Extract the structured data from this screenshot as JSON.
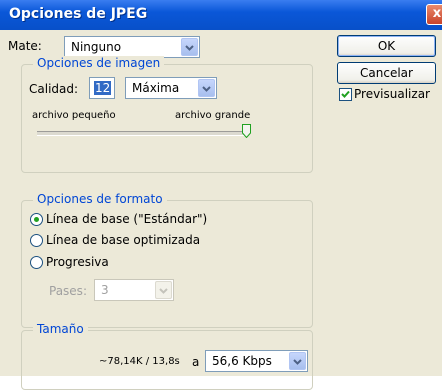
{
  "window": {
    "title": "Opciones de JPEG",
    "close_glyph": "x"
  },
  "matte": {
    "label": "Mate:",
    "value": "Ninguno"
  },
  "buttons": {
    "ok": "OK",
    "cancel": "Cancelar"
  },
  "preview": {
    "label": "Previsualizar",
    "checked": true
  },
  "image_options": {
    "legend": "Opciones de imagen",
    "quality_label": "Calidad:",
    "quality_value": "12",
    "quality_preset": "Máxima",
    "small_label": "archivo pequeño",
    "large_label": "archivo grande",
    "slider_level": 1.0
  },
  "format_options": {
    "legend": "Opciones de formato",
    "options": [
      "Línea de base (\"Estándar\")",
      "Línea de base optimizada",
      "Progresiva"
    ],
    "selected_index": 0,
    "scans_label": "Pases:",
    "scans_value": "3"
  },
  "size": {
    "legend": "Tamaño",
    "estimate": "~78,14K / 13,8s",
    "at_label": "a",
    "speed_value": "56,6 Kbps"
  },
  "icons": {
    "dropdown": "chevron-down-icon",
    "close": "close-icon",
    "check": "checkmark-icon"
  }
}
